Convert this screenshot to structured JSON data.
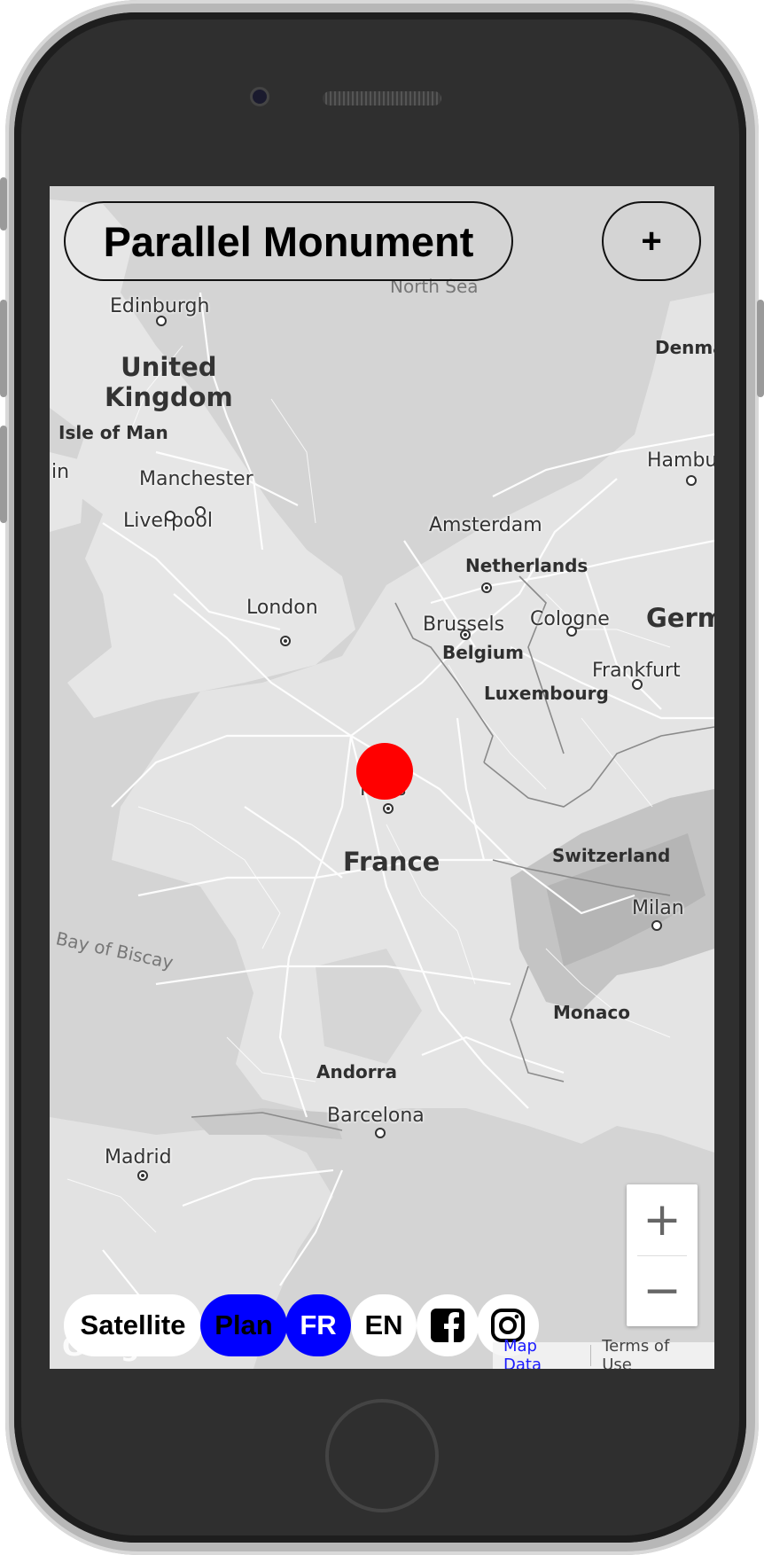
{
  "app": {
    "title": "Parallel Monument",
    "add_label": "+"
  },
  "map": {
    "sea_labels": {
      "north_sea": "North Sea",
      "bay_of_biscay": "Bay of Biscay"
    },
    "countries": {
      "united_kingdom": "United\nKingdom",
      "france": "France",
      "netherlands": "Netherlands",
      "belgium": "Belgium",
      "luxembourg": "Luxembourg",
      "switzerland": "Switzerland",
      "monaco": "Monaco",
      "andorra": "Andorra",
      "isle_of_man": "Isle of Man",
      "denmark_partial": "Denma",
      "germany_partial": "Germ"
    },
    "cities": {
      "edinburgh": "Edinburgh",
      "manchester": "Manchester",
      "liverpool": "Liverpool",
      "london": "London",
      "amsterdam": "Amsterdam",
      "brussels": "Brussels",
      "cologne": "Cologne",
      "frankfurt": "Frankfurt",
      "paris": "Paris",
      "milan": "Milan",
      "barcelona": "Barcelona",
      "madrid": "Madrid",
      "hamburg_partial": "Hambu",
      "dublin_partial": "in"
    },
    "marker_color": "#ff0000"
  },
  "zoom": {
    "in_label": "+",
    "out_label": "−"
  },
  "controls": {
    "satellite_label": "Satellite",
    "plan_label": "Plan",
    "fr_label": "FR",
    "en_label": "EN",
    "facebook_icon": "facebook-icon",
    "instagram_icon": "instagram-icon",
    "active_color": "#0000ff"
  },
  "attribution": {
    "map_data": "Map Data",
    "terms": "Terms of Use",
    "google": "Google"
  }
}
